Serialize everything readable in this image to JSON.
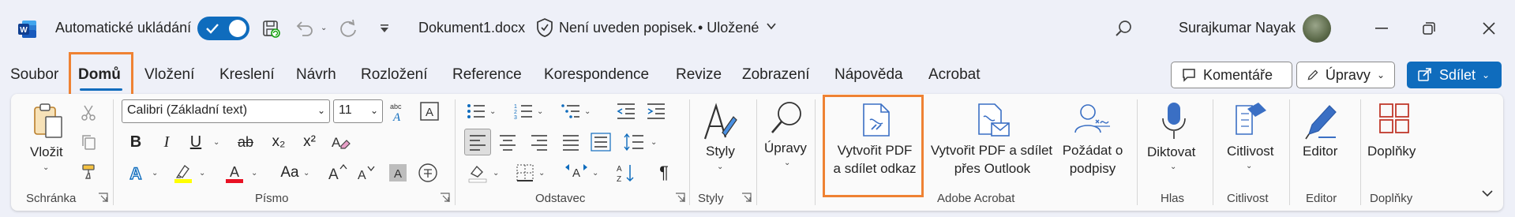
{
  "titlebar": {
    "autosave_label": "Automatické ukládání",
    "doc_name": "Dokument1.docx",
    "label_status": "Není uveden popisek.",
    "saved_status": "• Uložené",
    "user_name": "Surajkumar Nayak"
  },
  "tabs": [
    "Soubor",
    "Domů",
    "Vložení",
    "Kreslení",
    "Návrh",
    "Rozložení",
    "Reference",
    "Korespondence",
    "Revize",
    "Zobrazení",
    "Nápověda",
    "Acrobat"
  ],
  "actions": {
    "comments": "Komentáře",
    "editing": "Úpravy",
    "share": "Sdílet"
  },
  "clipboard": {
    "paste": "Vložit",
    "group": "Schránka"
  },
  "font": {
    "family": "Calibri (Základní text)",
    "size": "11",
    "group": "Písmo",
    "bold": "B",
    "italic": "I",
    "underline": "U",
    "strike": "ab",
    "subscript": "x₂",
    "superscript": "x²",
    "change_case": "Aa",
    "grow": "A^",
    "shrink": "A˅",
    "highlight_chars": "A"
  },
  "paragraph": {
    "group": "Odstavec",
    "pilcrow": "¶"
  },
  "styles": {
    "label": "Styly",
    "group": "Styly"
  },
  "editing_group": {
    "label": "Úpravy"
  },
  "acrobat": {
    "create_share_line1": "Vytvořit PDF",
    "create_share_line2": "a sdílet odkaz",
    "create_outlook_line1": "Vytvořit PDF a sdílet",
    "create_outlook_line2": "přes Outlook",
    "request_sign_line1": "Požádat o",
    "request_sign_line2": "podpisy",
    "group": "Adobe Acrobat"
  },
  "voice": {
    "dictate": "Diktovat",
    "group": "Hlas"
  },
  "sensitivity": {
    "label": "Citlivost",
    "group": "Citlivost"
  },
  "editor": {
    "label": "Editor",
    "group": "Editor"
  },
  "addins": {
    "label": "Doplňky",
    "group": "Doplňky"
  },
  "colors": {
    "accent": "#0f6cbd",
    "highlight_outline": "#ef8233",
    "word_blue": "#185abd",
    "acrobat_icon": "#3a6fc4",
    "addins_icon": "#c0392b"
  }
}
